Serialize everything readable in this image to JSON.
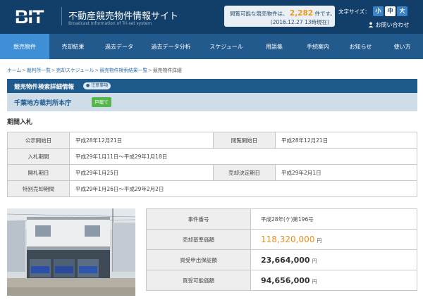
{
  "header": {
    "logo_text": "BIT",
    "site_title": "不動産競売物件情報サイト",
    "site_subtitle": "Broadcast Information of Tri-set system",
    "count_prefix": "閲覧可能な競売物件は、",
    "count_value": "2,282",
    "count_suffix": "件です。",
    "count_date": "(2016.12.27 13時現在)",
    "font_size_label": "文字サイズ：",
    "font_small": "小",
    "font_medium": "中",
    "font_large": "大",
    "contact": "お問い合わせ"
  },
  "nav": {
    "items": [
      {
        "label": "競売物件",
        "active": true
      },
      {
        "label": "売却結果",
        "active": false
      },
      {
        "label": "過去データ",
        "active": false
      },
      {
        "label": "過去データ分析",
        "active": false
      },
      {
        "label": "スケジュール",
        "active": false
      },
      {
        "label": "用語集",
        "active": false
      },
      {
        "label": "手続案内",
        "active": false
      },
      {
        "label": "お知らせ",
        "active": false
      },
      {
        "label": "使い方",
        "active": false
      }
    ]
  },
  "breadcrumb": {
    "items": [
      "ホーム",
      "裁判所一覧",
      "売却スケジュール",
      "競売物件検索結果一覧",
      "競売物件詳細"
    ]
  },
  "search": {
    "title": "競売物件検索詳細情報",
    "notice": "注意事項"
  },
  "court": {
    "name": "千葉地方裁判所本庁",
    "tag": "戸建て"
  },
  "period": {
    "heading": "期間入札",
    "public_start_label": "公示開始日",
    "public_start_value": "平成28年12月21日",
    "view_start_label": "閲覧開始日",
    "view_start_value": "平成28年12月21日",
    "bid_period_label": "入札期間",
    "bid_period_value": "平成29年1月11日〜平成29年1月18日",
    "opening_label": "開札期日",
    "opening_value": "平成29年1月25日",
    "decision_label": "売却決定期日",
    "decision_value": "平成29年2月1日",
    "special_label": "特別売却期間",
    "special_value": "平成29年1月26日〜平成29年2月2日"
  },
  "case": {
    "case_no_label": "事件番号",
    "case_no_value": "平成28年(ケ)第196号",
    "base_price_label": "売却基準価額",
    "base_price_value": "118,320,000",
    "deposit_label": "買受申出保証額",
    "deposit_value": "23,664,000",
    "possible_label": "買受可能価額",
    "possible_value": "94,656,000",
    "yen": "円"
  }
}
